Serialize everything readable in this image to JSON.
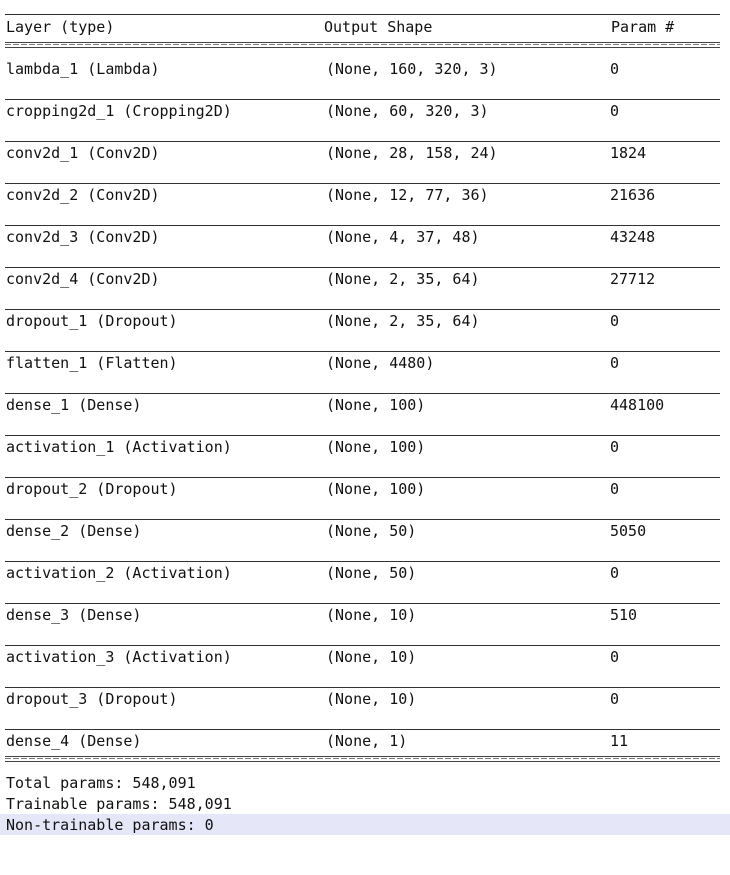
{
  "header": {
    "layer": "Layer (type)",
    "shape": "Output Shape",
    "param": "Param #"
  },
  "rows": [
    {
      "layer": "lambda_1 (Lambda)",
      "shape": "(None, 160, 320, 3)",
      "param": "0"
    },
    {
      "layer": "cropping2d_1 (Cropping2D)",
      "shape": "(None, 60, 320, 3)",
      "param": "0"
    },
    {
      "layer": "conv2d_1 (Conv2D)",
      "shape": "(None, 28, 158, 24)",
      "param": "1824"
    },
    {
      "layer": "conv2d_2 (Conv2D)",
      "shape": "(None, 12, 77, 36)",
      "param": "21636"
    },
    {
      "layer": "conv2d_3 (Conv2D)",
      "shape": "(None, 4, 37, 48)",
      "param": "43248"
    },
    {
      "layer": "conv2d_4 (Conv2D)",
      "shape": "(None, 2, 35, 64)",
      "param": "27712"
    },
    {
      "layer": "dropout_1 (Dropout)",
      "shape": "(None, 2, 35, 64)",
      "param": "0"
    },
    {
      "layer": "flatten_1 (Flatten)",
      "shape": "(None, 4480)",
      "param": "0"
    },
    {
      "layer": "dense_1 (Dense)",
      "shape": "(None, 100)",
      "param": "448100"
    },
    {
      "layer": "activation_1 (Activation)",
      "shape": "(None, 100)",
      "param": "0"
    },
    {
      "layer": "dropout_2 (Dropout)",
      "shape": "(None, 100)",
      "param": "0"
    },
    {
      "layer": "dense_2 (Dense)",
      "shape": "(None, 50)",
      "param": "5050"
    },
    {
      "layer": "activation_2 (Activation)",
      "shape": "(None, 50)",
      "param": "0"
    },
    {
      "layer": "dense_3 (Dense)",
      "shape": "(None, 10)",
      "param": "510"
    },
    {
      "layer": "activation_3 (Activation)",
      "shape": "(None, 10)",
      "param": "0"
    },
    {
      "layer": "dropout_3 (Dropout)",
      "shape": "(None, 10)",
      "param": "0"
    },
    {
      "layer": "dense_4 (Dense)",
      "shape": "(None, 1)",
      "param": "11"
    }
  ],
  "totals": {
    "total": "Total params: 548,091",
    "trainable": "Trainable params: 548,091",
    "non_trainable": "Non-trainable params: 0"
  },
  "colors": {
    "selection_highlight": "#e5e6f8"
  }
}
